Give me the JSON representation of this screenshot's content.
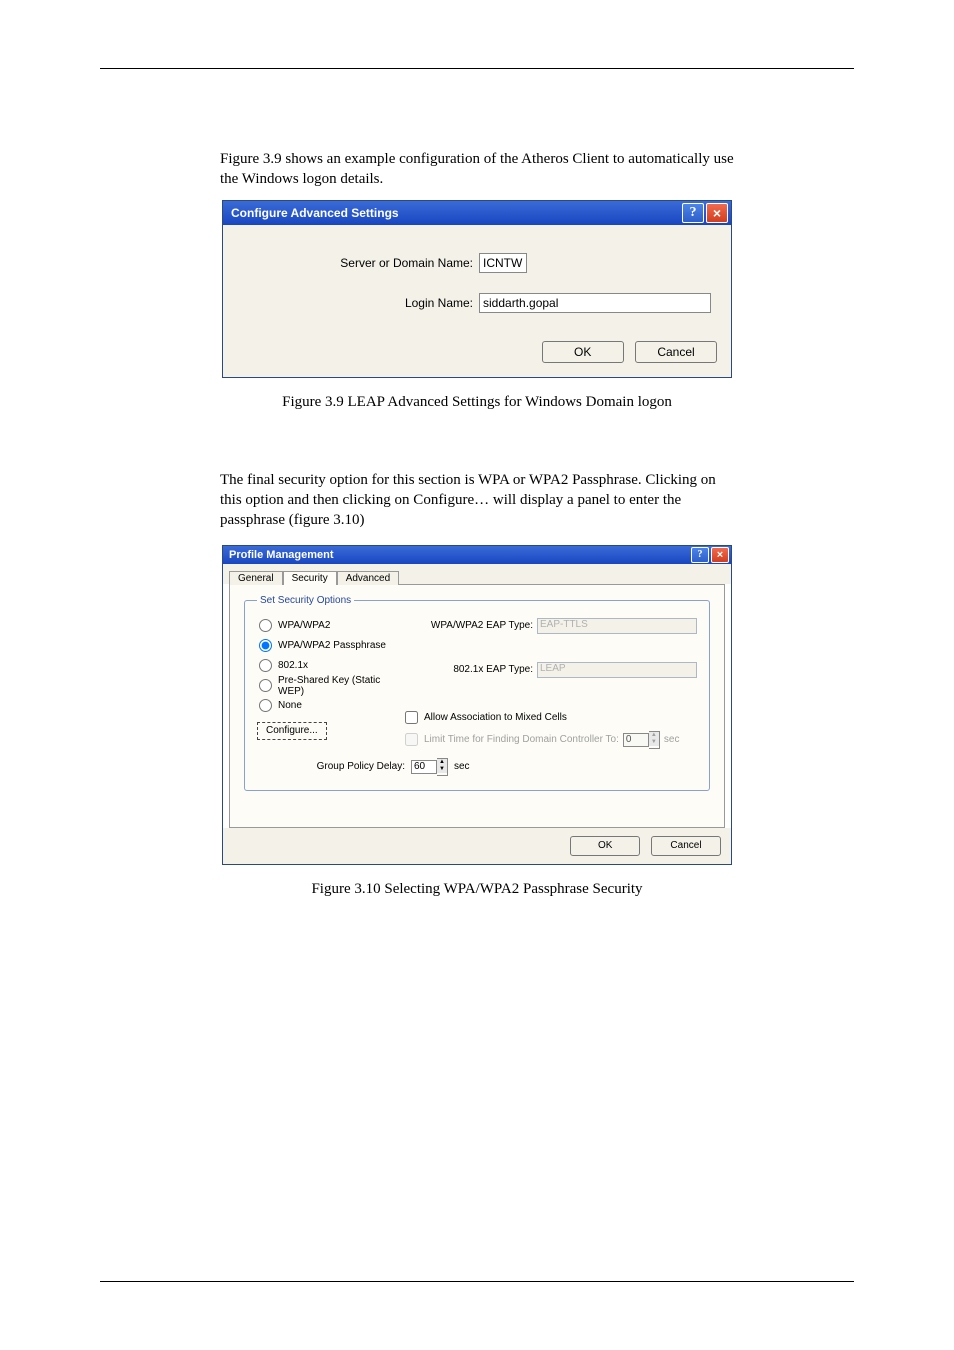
{
  "paras": {
    "p1": "Figure 3.9 shows an example configuration of the Atheros Client to automatically use the Windows logon details.",
    "p2": "",
    "p3": "The final security option for this section is WPA or WPA2 Passphrase. Clicking on this option and then clicking on Configure… will display a panel to enter the passphrase (figure 3.10)"
  },
  "figcap": {
    "f1": "Figure 3.9 LEAP Advanced Settings for Windows Domain logon",
    "f2": "Figure 3.10 Selecting WPA/WPA2 Passphrase Security"
  },
  "dlg1": {
    "title": "Configure Advanced Settings",
    "labels": {
      "server": "Server or Domain Name:",
      "login": "Login Name:"
    },
    "values": {
      "server": "ICNTW",
      "login": "siddarth.gopal"
    },
    "buttons": {
      "ok": "OK",
      "cancel": "Cancel"
    }
  },
  "dlg2": {
    "title": "Profile Management",
    "tabs": {
      "general": "General",
      "security": "Security",
      "advanced": "Advanced"
    },
    "fieldset_legend": "Set Security Options",
    "radios": {
      "wpa": "WPA/WPA2",
      "pass": "WPA/WPA2 Passphrase",
      "dot1x": "802.1x",
      "psk": "Pre-Shared Key (Static WEP)",
      "none": "None"
    },
    "right_labels": {
      "wpa_eap": "WPA/WPA2 EAP Type:",
      "dot1x_eap": "802.1x EAP Type:"
    },
    "right_values": {
      "wpa_eap": "EAP-TTLS",
      "dot1x_eap": "LEAP"
    },
    "configure_btn": "Configure...",
    "checks": {
      "mixed": "Allow Association to Mixed Cells",
      "limit": "Limit Time for Finding Domain Controller To:"
    },
    "limit_value": "0",
    "sec_label": "sec",
    "gp_label": "Group Policy Delay:",
    "gp_value": "60",
    "buttons": {
      "ok": "OK",
      "cancel": "Cancel"
    }
  }
}
